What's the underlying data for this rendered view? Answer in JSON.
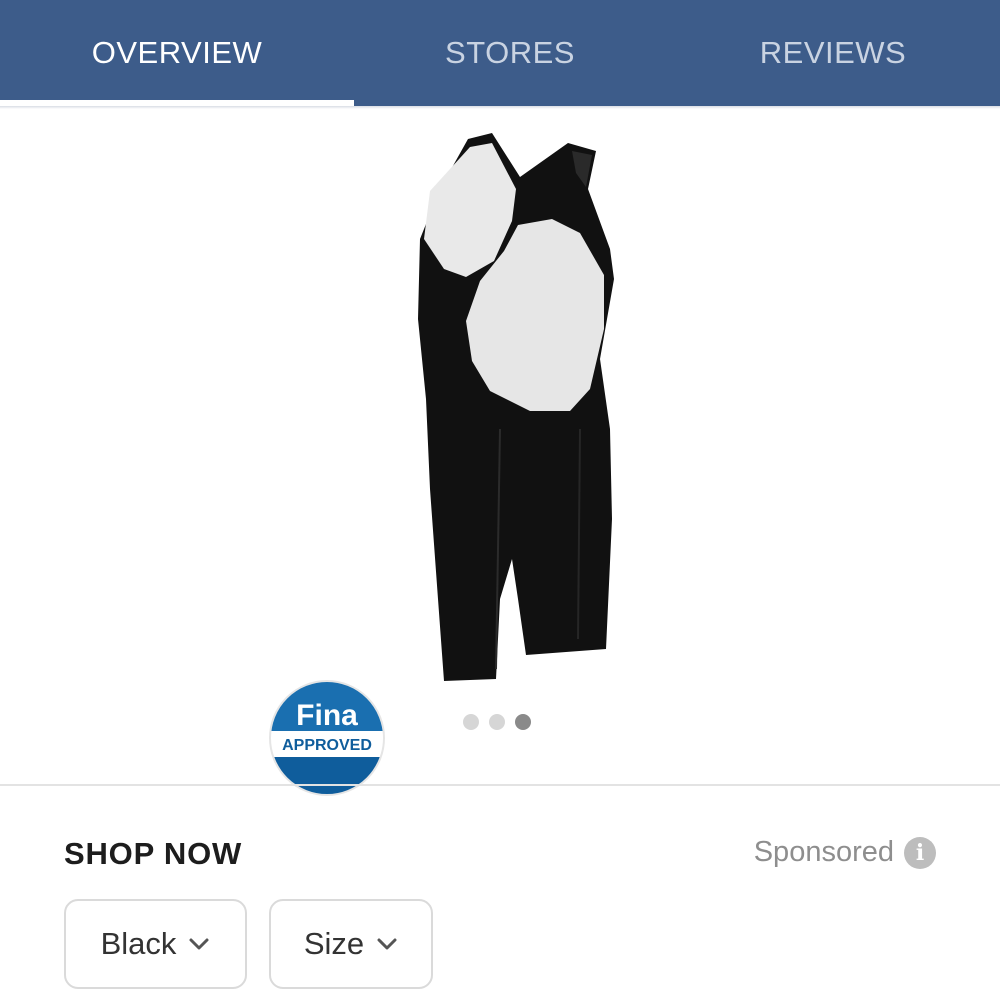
{
  "tabs": [
    {
      "label": "OVERVIEW",
      "active": true
    },
    {
      "label": "STORES",
      "active": false
    },
    {
      "label": "REVIEWS",
      "active": false
    }
  ],
  "colors": {
    "tabbar": "#3d5c8a",
    "tab_active": "#ffffff",
    "tab_inactive": "#c9d3e2",
    "badge_blue": "#1a6fb0"
  },
  "carousel": {
    "badge": {
      "line1": "Fina",
      "line2": "APPROVED"
    },
    "page_count": 3,
    "active_page": 3
  },
  "shop": {
    "title": "SHOP NOW",
    "sponsored": "Sponsored",
    "info_icon": "i"
  },
  "selectors": {
    "color": "Black",
    "size": "Size"
  }
}
